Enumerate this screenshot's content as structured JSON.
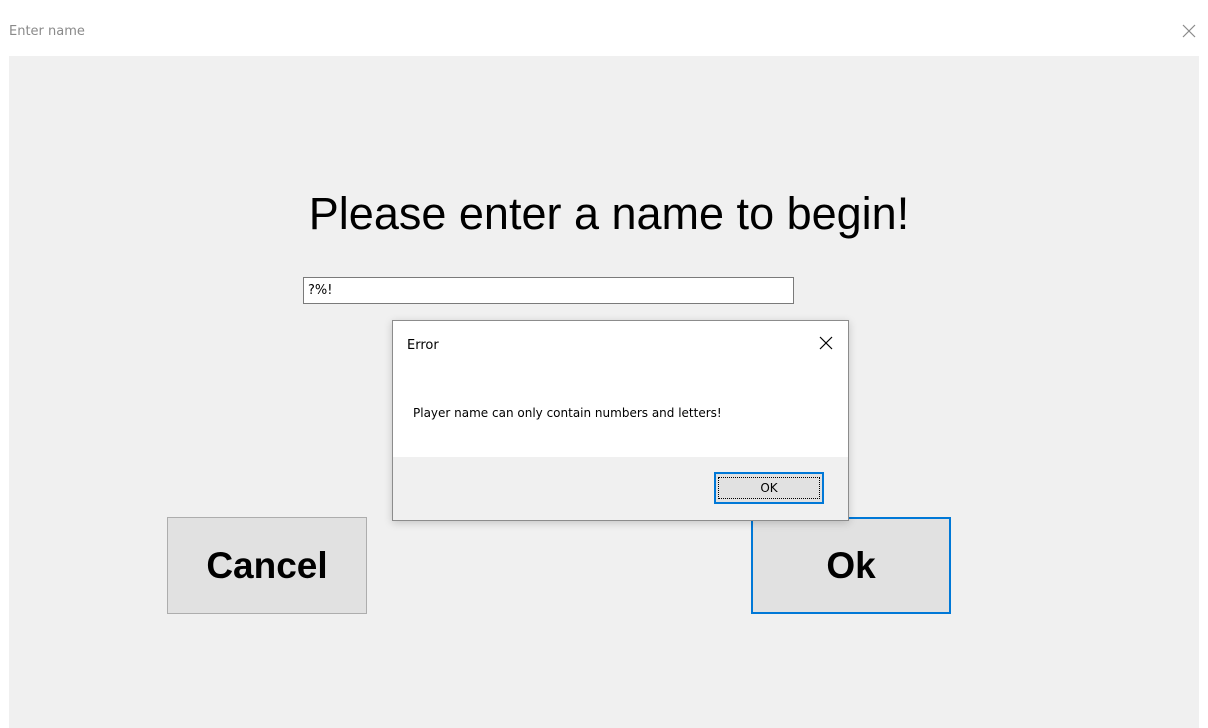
{
  "window": {
    "title": "Enter name",
    "close_icon": "close-icon"
  },
  "form": {
    "heading": "Please enter a name to begin!",
    "name_value": "?%!",
    "cancel_label": "Cancel",
    "ok_label": "Ok"
  },
  "error_dialog": {
    "title": "Error",
    "message": "Player name can only contain numbers and letters!",
    "ok_label": "OK",
    "close_icon": "close-icon"
  },
  "colors": {
    "client_background": "#f0f0f0",
    "button_face": "#e1e1e1",
    "focus_accent": "#0078d7"
  }
}
